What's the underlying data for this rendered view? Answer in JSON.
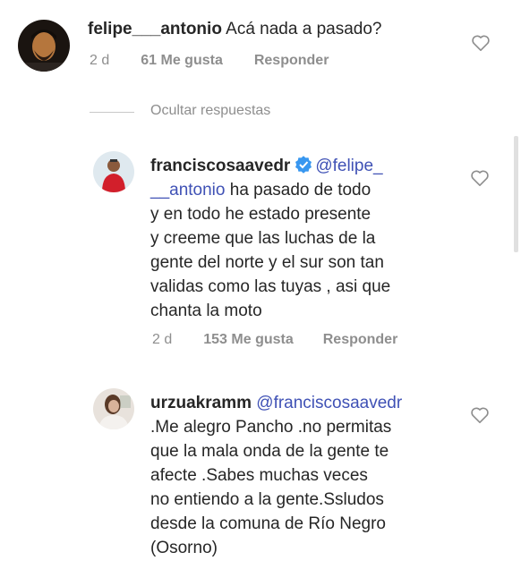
{
  "comments": [
    {
      "username": "felipe___antonio",
      "text": "Acá nada a pasado?",
      "time": "2 d",
      "likes": "61 Me gusta",
      "reply": "Responder"
    },
    {
      "username": "franciscosaavedr",
      "mention": "@felipe___antonio",
      "text_lines": [
        "ha pasado de todo",
        "y en todo he estado presente",
        "y creeme que las luchas de la",
        "gente del norte y el sur son tan",
        "validas como las tuyas , asi que",
        "chanta la moto"
      ],
      "time": "2 d",
      "likes": "153 Me gusta",
      "reply": "Responder"
    },
    {
      "username": "urzuakramm",
      "mention": "@franciscosaavedr",
      "text_lines": [
        ".Me alegro Pancho .no permitas",
        "que la mala onda de la gente te",
        "afecte .Sabes muchas veces",
        "no entiendo a la gente.Ssludos",
        "desde la comuna de Río Negro",
        "(Osorno)"
      ]
    }
  ],
  "hide_replies": "Ocultar respuestas",
  "icons": {
    "like": "heart-outline-icon",
    "verified": "verified-badge-icon"
  },
  "colors": {
    "mention": "#3f51b5",
    "verified": "#3897f0",
    "meta": "#8e8e8e"
  }
}
